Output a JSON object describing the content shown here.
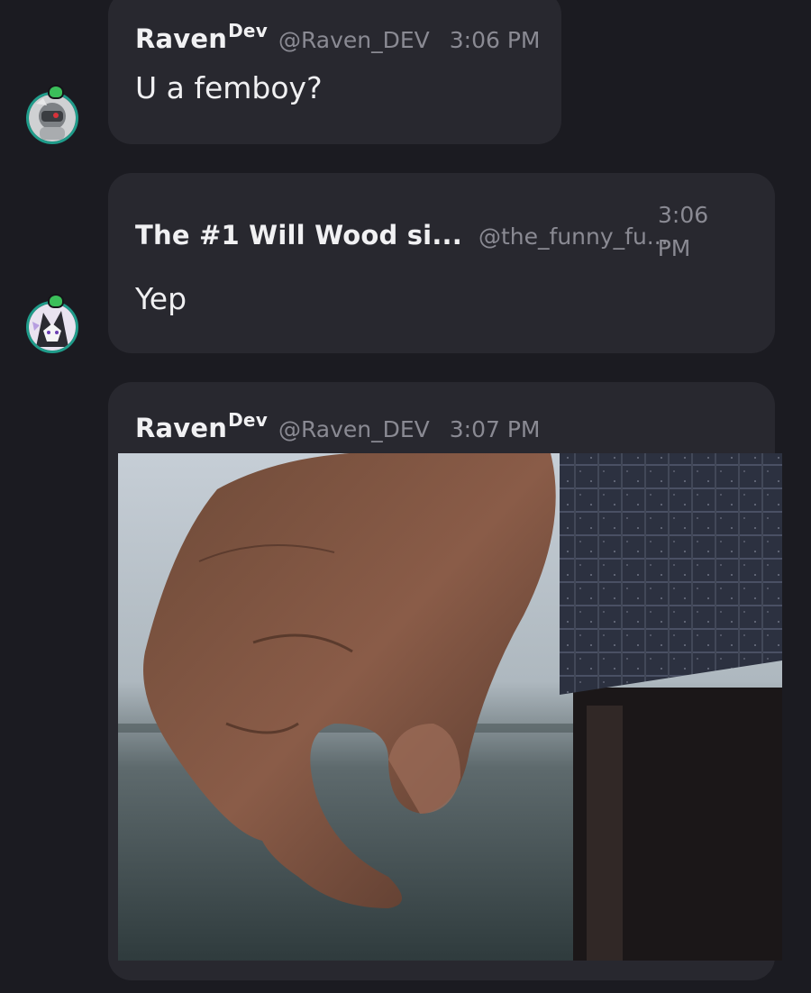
{
  "messages": [
    {
      "display_name": "Raven",
      "display_name_super": "Dev",
      "handle": "@Raven_DEV",
      "time": "3:06 PM",
      "text": "U a femboy?",
      "avatar_icon": "robot-avatar-icon"
    },
    {
      "display_name": "The #1 Will Wood si...",
      "handle": "@the_funny_fu...",
      "time_line1": "3:06",
      "time_line2": "PM",
      "text": "Yep",
      "avatar_icon": "fox-avatar-icon"
    },
    {
      "display_name": "Raven",
      "display_name_super": "Dev",
      "handle": "@Raven_DEV",
      "time": "3:07 PM",
      "attachment_icon": "hand-photo-image"
    }
  ],
  "colors": {
    "background": "#1b1b21",
    "bubble": "#28282f",
    "avatar_ring": "#1f9c8a",
    "badge": "#3bbf5a",
    "name_text": "#f1f1f3",
    "muted_text": "#8a8a93"
  }
}
